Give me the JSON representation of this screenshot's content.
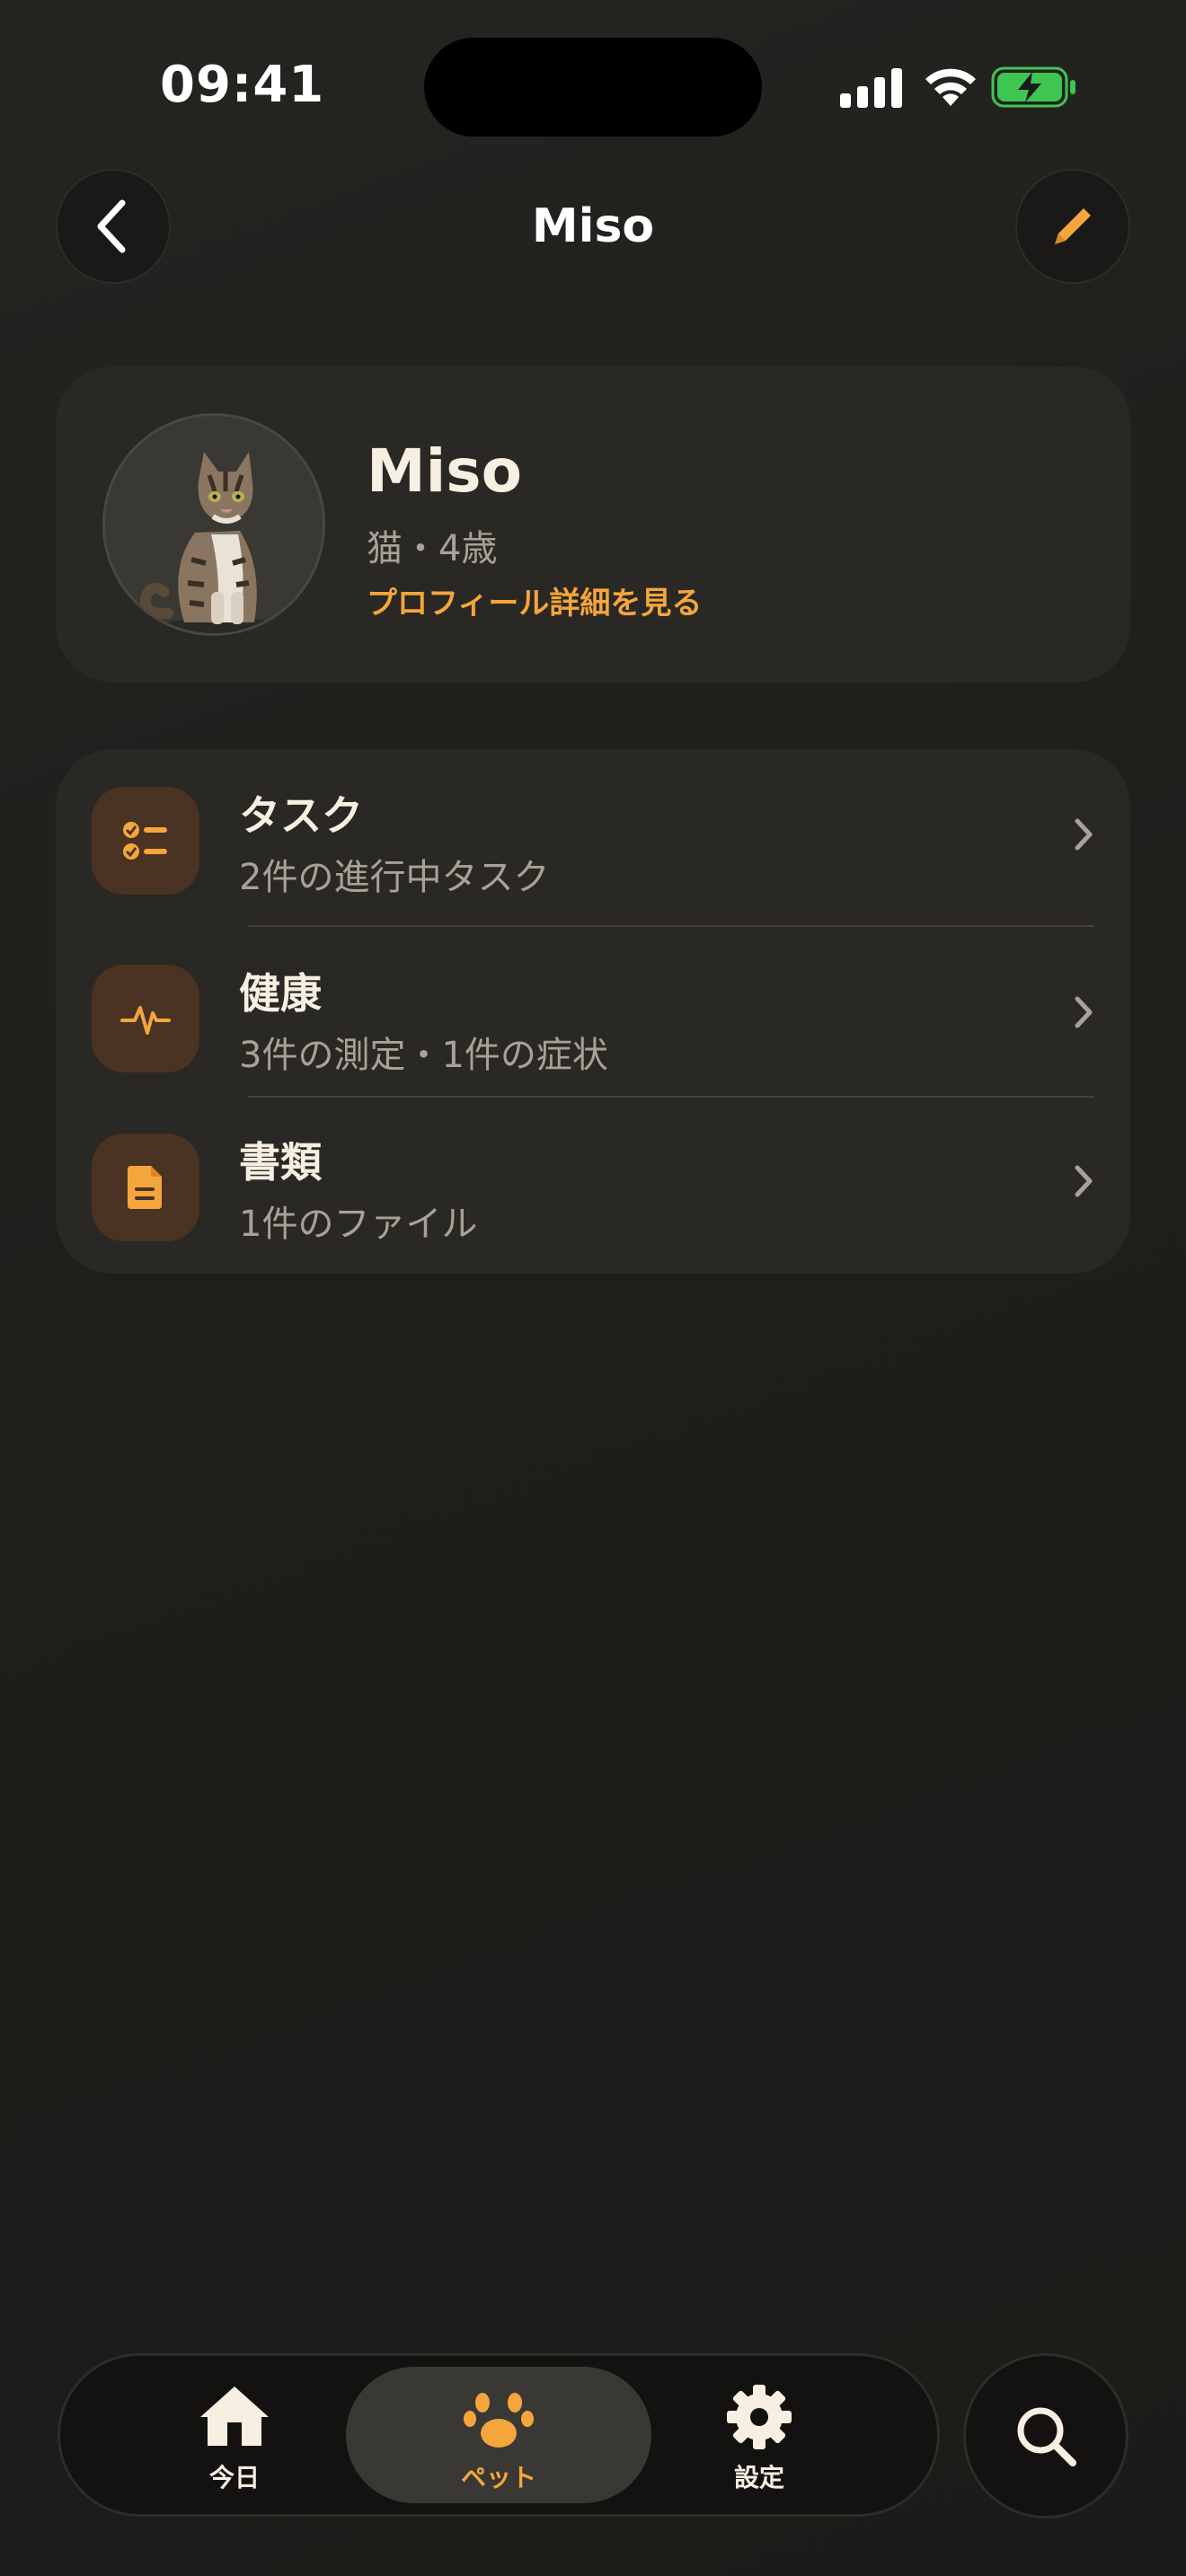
{
  "status_bar": {
    "time": "09:41"
  },
  "header": {
    "title": "Miso"
  },
  "profile": {
    "name": "Miso",
    "meta": "猫・4歳",
    "link": "プロフィール詳細を見る"
  },
  "menu": {
    "items": [
      {
        "title": "タスク",
        "subtitle": "2件の進行中タスク",
        "icon": "checklist-icon"
      },
      {
        "title": "健康",
        "subtitle": "3件の測定・1件の症状",
        "icon": "pulse-icon"
      },
      {
        "title": "書類",
        "subtitle": "1件のファイル",
        "icon": "document-icon"
      }
    ]
  },
  "tabbar": {
    "tabs": [
      {
        "label": "今日",
        "icon": "home-icon",
        "selected": false
      },
      {
        "label": "ペット",
        "icon": "paw-icon",
        "selected": true
      },
      {
        "label": "設定",
        "icon": "gear-icon",
        "selected": false
      }
    ]
  },
  "colors": {
    "accent": "#f4a63c",
    "background": "#1e1d1a",
    "card": "#2a2824",
    "battery": "#3ec552"
  }
}
